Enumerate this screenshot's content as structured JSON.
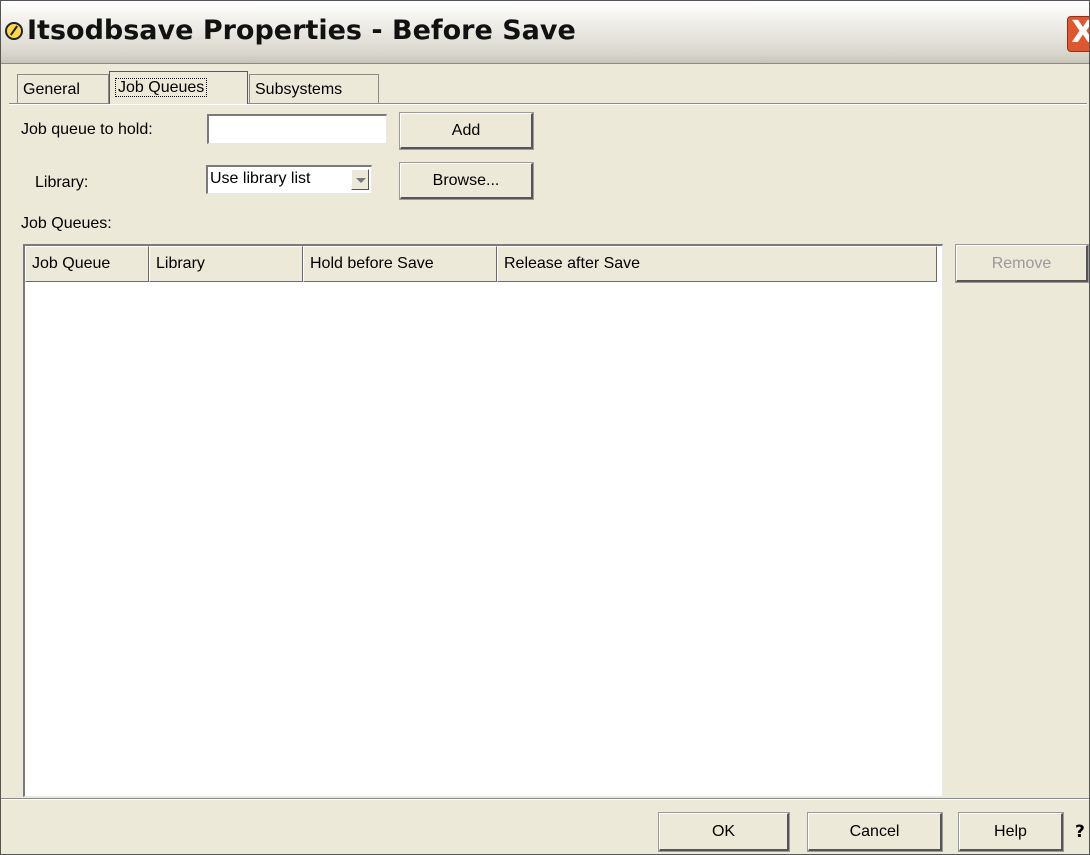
{
  "window": {
    "title": "Itsodbsave Properties - Before Save",
    "close_label": "X"
  },
  "tabs": [
    {
      "label": "General",
      "active": false
    },
    {
      "label": "Job Queues",
      "active": true
    },
    {
      "label": "Subsystems",
      "active": false
    }
  ],
  "form": {
    "job_queue_label": "Job queue to hold:",
    "job_queue_value": "",
    "add_label": "Add",
    "library_label": "Library:",
    "library_value": "Use library list",
    "browse_label": "Browse..."
  },
  "table": {
    "title": "Job Queues:",
    "columns": [
      "Job Queue",
      "Library",
      "Hold before Save",
      "Release after Save"
    ],
    "rows": []
  },
  "remove_label": "Remove",
  "footer": {
    "ok_label": "OK",
    "cancel_label": "Cancel",
    "help_label": "Help",
    "whats_this_label": "?"
  },
  "icons": {
    "title_icon": "system-object-icon",
    "combo_arrow": "chevron-down-icon"
  }
}
